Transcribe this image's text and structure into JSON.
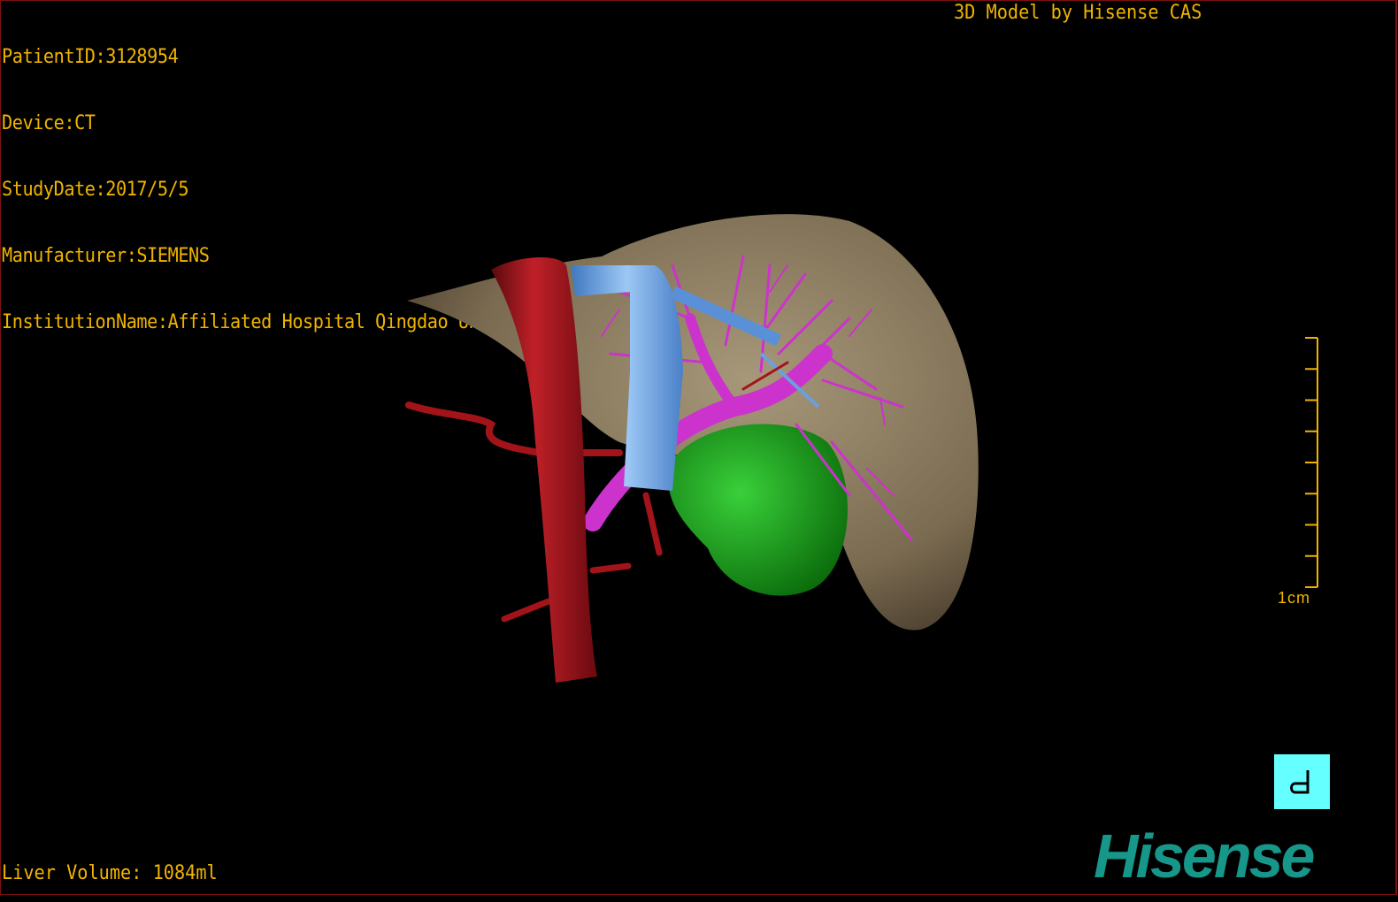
{
  "header": {
    "patient_id": "PatientID:3128954",
    "device": "Device:CT",
    "study_date": "StudyDate:2017/5/5",
    "manufacturer": "Manufacturer:SIEMENS",
    "institution": "InstitutionName:Affiliated Hospital Qingdao University-C",
    "model_credit": "3D Model by Hisense CAS"
  },
  "footer": {
    "liver_volume": "Liver Volume: 1084ml"
  },
  "scale_bar": {
    "label": "1cm",
    "ticks": 9
  },
  "orientation_marker": {
    "label": "d",
    "color": "#66ffff"
  },
  "logo": {
    "text": "Hisense",
    "color": "#17968a"
  },
  "colors": {
    "text": "#f0b400",
    "liver": "#8a7a5e",
    "artery": "#a3141a",
    "vein": "#6fa8e8",
    "portal_vein": "#cc33cc",
    "tumor": "#1a9e1a",
    "frame": "#7a1010"
  }
}
